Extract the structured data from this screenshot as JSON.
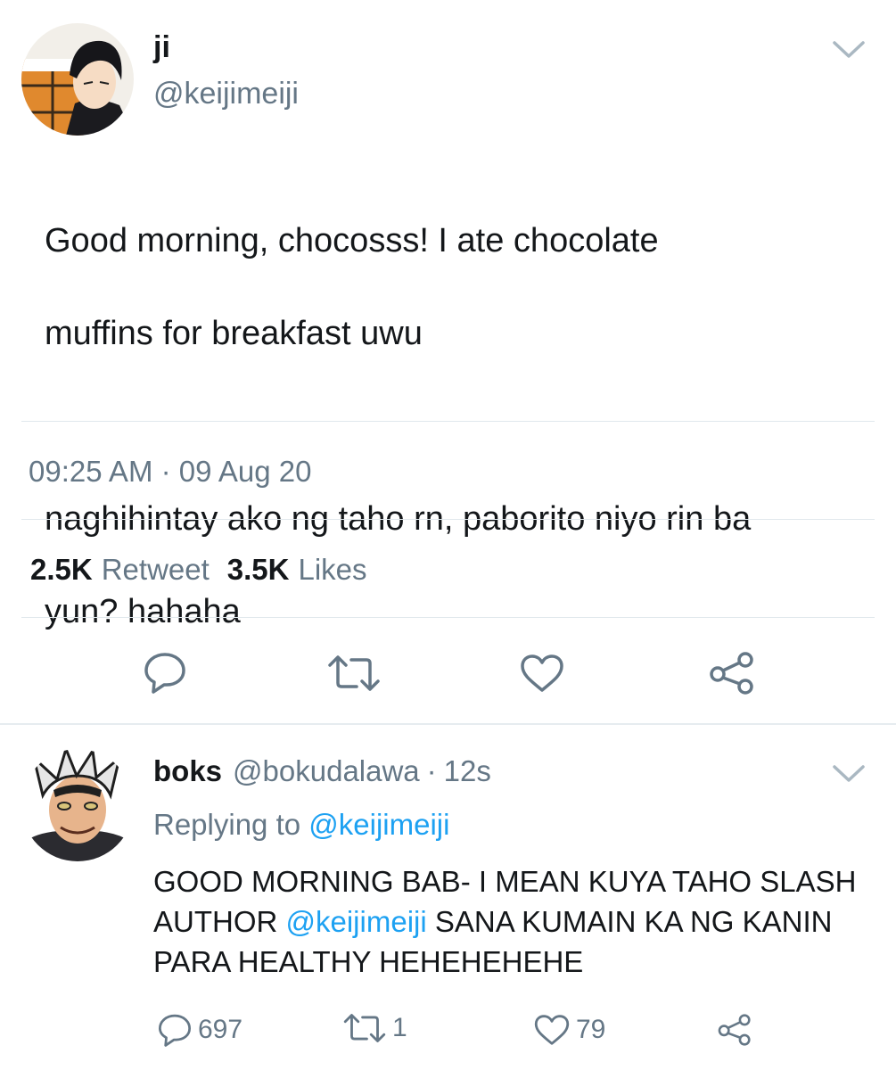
{
  "tweet": {
    "author": {
      "name": "ji",
      "handle": "@keijimeiji",
      "avatar": "anime-boy-avatar"
    },
    "text_line1": "Good morning, chocosss! I ate chocolate",
    "text_line2": "muffins for breakfast uwu",
    "text_line3": "naghihintay ako ng taho rn, paborito niyo rin ba",
    "text_line4": "yun? hahaha",
    "time": "09:25 AM",
    "separator": "·",
    "date": "09 Aug 20",
    "stats": {
      "retweets_count": "2.5K",
      "retweets_label": "Retweet",
      "likes_count": "3.5K",
      "likes_label": "Likes"
    },
    "actions": [
      "reply-icon",
      "retweet-icon",
      "like-icon",
      "share-icon"
    ]
  },
  "reply": {
    "author": {
      "name": "boks",
      "handle": "@bokudalawa",
      "avatar": "anime-spiky-hair-avatar"
    },
    "separator": "·",
    "age": "12s",
    "replying_prefix": "Replying to",
    "replying_handle": "@keijimeiji",
    "text_part1": "GOOD MORNING BAB- I MEAN KUYA TAHO SLASH AUTHOR ",
    "mention": "@keijimeiji",
    "text_part2": " SANA KUMAIN KA NG KANIN PARA HEALTHY HEHEHEHEHE",
    "counts": {
      "replies": "697",
      "retweets": "1",
      "likes": "79"
    }
  },
  "colors": {
    "text": "#14171a",
    "muted": "#657786",
    "link": "#1da1f2",
    "divider": "#e1e8ed"
  }
}
